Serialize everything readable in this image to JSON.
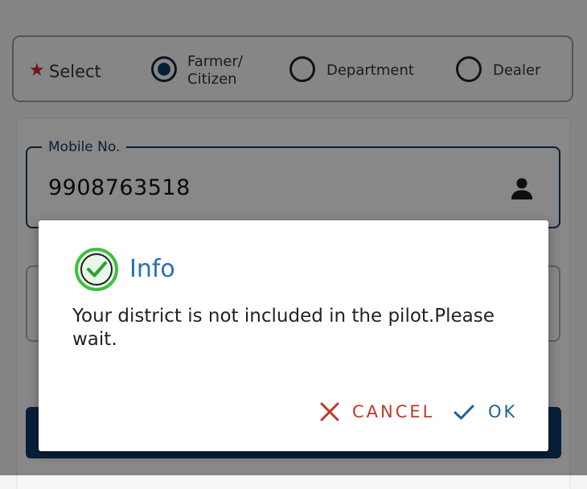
{
  "user_type": {
    "required_marker": "★",
    "label": "Select",
    "options": [
      {
        "label_line1": "Farmer/",
        "label_line2": "Citizen",
        "selected": true
      },
      {
        "label": "Department",
        "selected": false
      },
      {
        "label": "Dealer",
        "selected": false
      }
    ]
  },
  "form": {
    "mobile_label": "Mobile No.",
    "mobile_value": "9908763518",
    "mobile_icon": "person-icon"
  },
  "dialog": {
    "icon": "check-circle-icon",
    "title": "Info",
    "message": "Your district is not included in the pilot.Please wait.",
    "cancel_label": "CANCEL",
    "ok_label": "OK"
  },
  "colors": {
    "primary": "#0d3b66",
    "info_title": "#2a6fb3",
    "success_green": "#3fbf3f",
    "cancel_red": "#c0392b",
    "ok_blue": "#1f5f99"
  }
}
